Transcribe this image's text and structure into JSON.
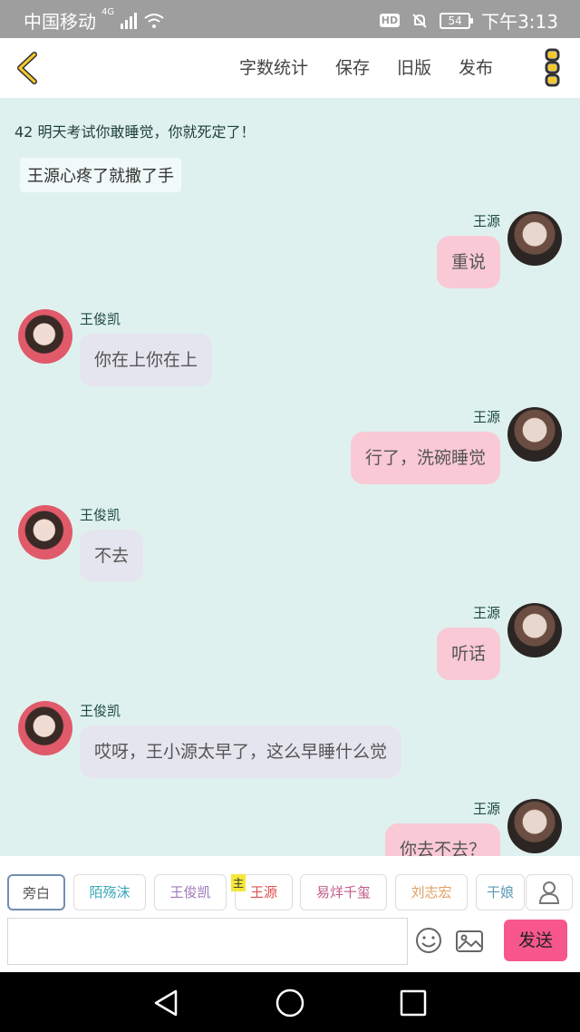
{
  "status_bar": {
    "carrier": "中国移动",
    "network": "4G",
    "hd": "HD",
    "battery": "54",
    "time": "下午3:13"
  },
  "header": {
    "menu": [
      "字数统计",
      "保存",
      "旧版",
      "发布"
    ]
  },
  "chat": {
    "intro": "42 明天考试你敢睡觉，你就死定了！",
    "narration": "王源心疼了就撒了手",
    "messages": [
      {
        "side": "right",
        "name": "王源",
        "text": "重说"
      },
      {
        "side": "left",
        "name": "王俊凯",
        "text": "你在上你在上"
      },
      {
        "side": "right",
        "name": "王源",
        "text": "行了，洗碗睡觉"
      },
      {
        "side": "left",
        "name": "王俊凯",
        "text": "不去"
      },
      {
        "side": "right",
        "name": "王源",
        "text": "听话"
      },
      {
        "side": "left",
        "name": "王俊凯",
        "text": "哎呀，王小源太早了，这么早睡什么觉"
      },
      {
        "side": "right",
        "name": "王源",
        "text": "你去不去？"
      }
    ]
  },
  "roles": {
    "items": [
      {
        "label": "旁白",
        "color": "#555555"
      },
      {
        "label": "陌殇沫",
        "color": "#3aa8b8"
      },
      {
        "label": "王俊凯",
        "color": "#a07ab8"
      },
      {
        "label": "王源",
        "color": "#e05050"
      },
      {
        "label": "易烊千玺",
        "color": "#c05a8a"
      },
      {
        "label": "刘志宏",
        "color": "#e0a060"
      },
      {
        "label": "干娘",
        "color": "#5a9ab8"
      }
    ],
    "main_tag": "主"
  },
  "composer": {
    "send_label": "发送"
  },
  "icons": {
    "back": "chevron-left-icon",
    "more": "more-vertical-icon",
    "profile": "user-icon",
    "emoji": "smiley-icon",
    "image": "image-icon",
    "nav": [
      "back-triangle-icon",
      "home-circle-icon",
      "recents-square-icon"
    ]
  },
  "colors": {
    "accent": "#f2c92c",
    "send": "#f7578c",
    "right_bubble": "#f9c9d5",
    "left_bubble": "#e5e5ef",
    "chat_bg": "#dff1ef"
  }
}
